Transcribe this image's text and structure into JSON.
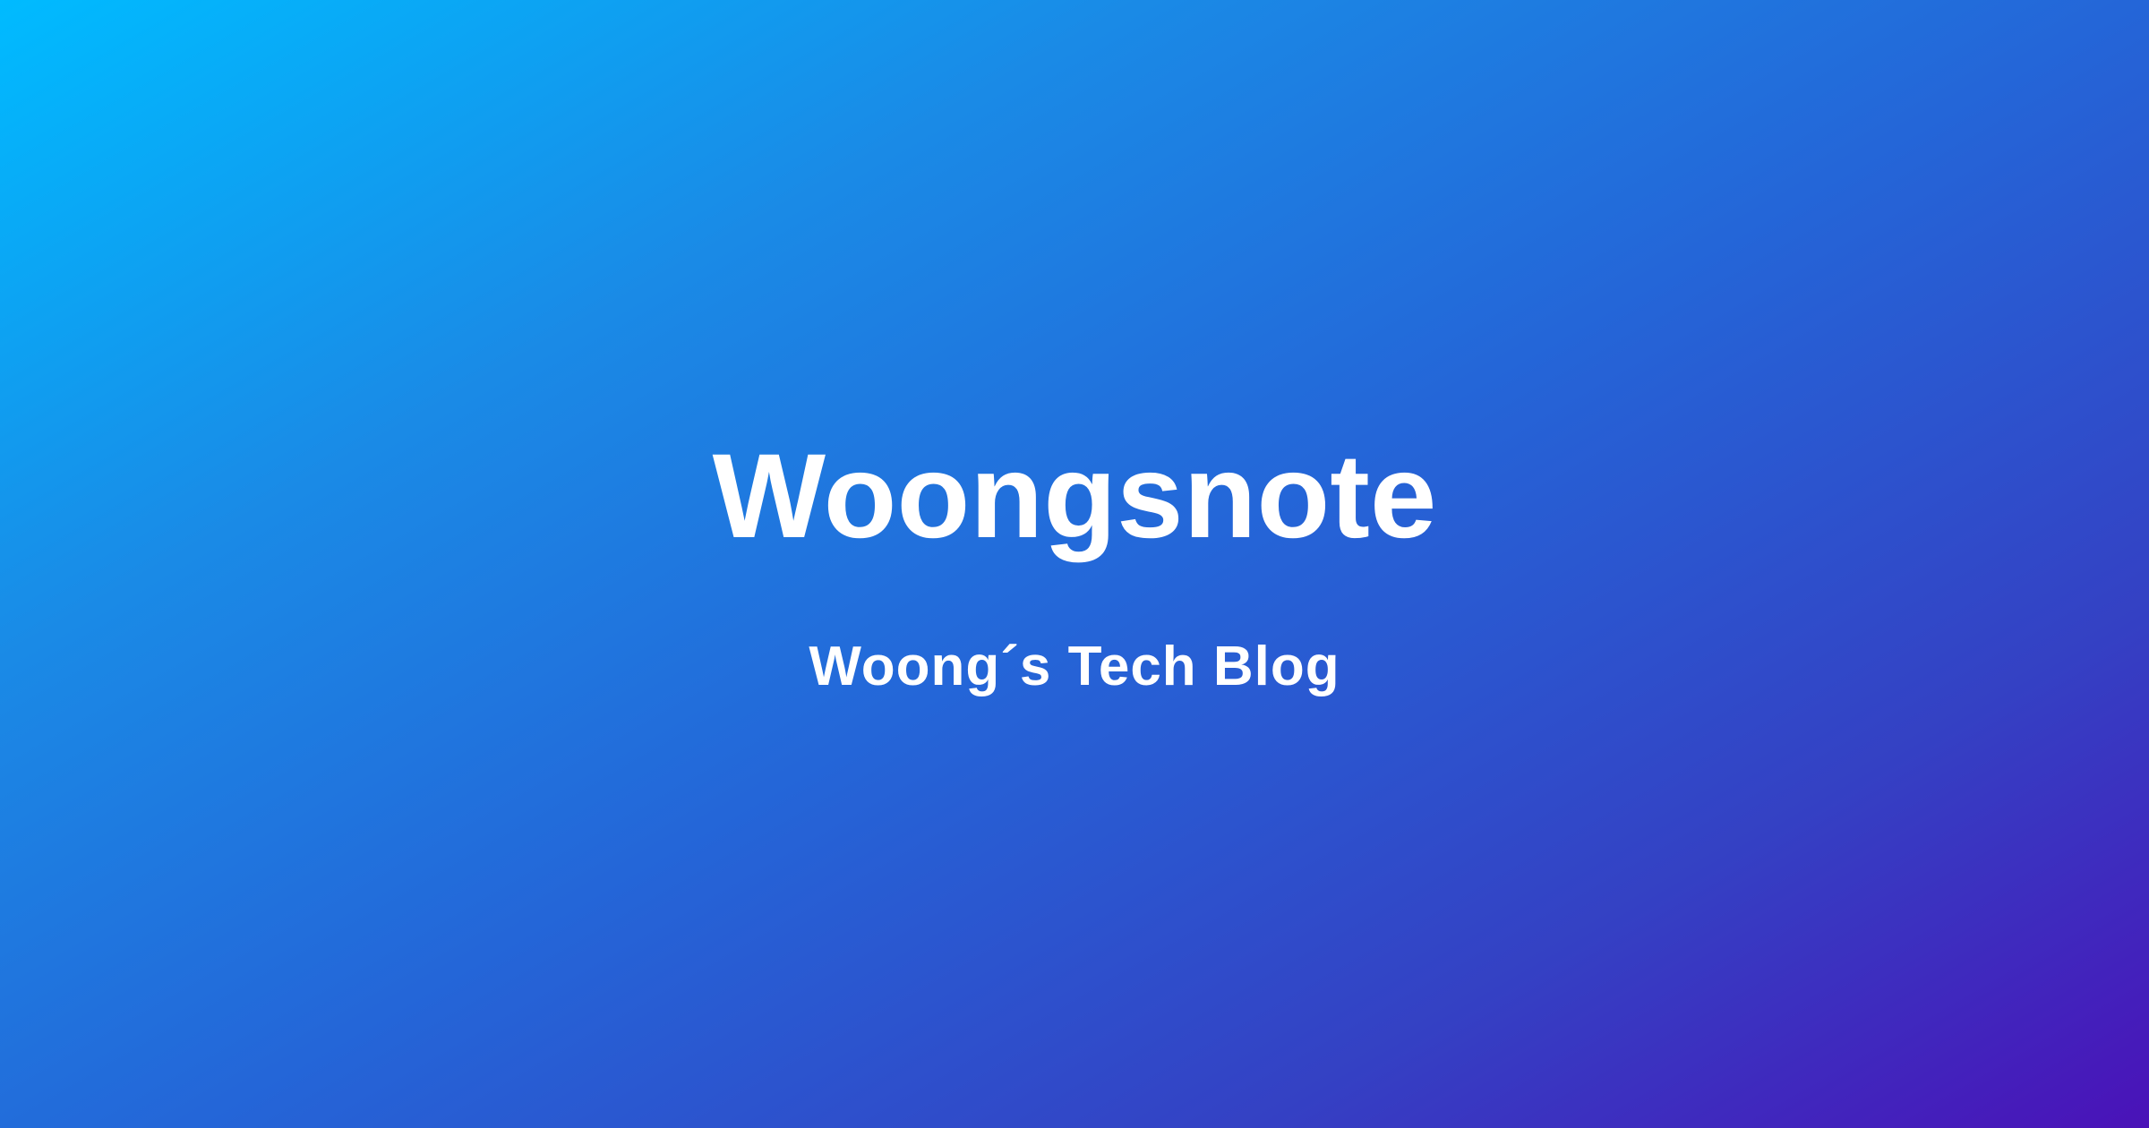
{
  "hero": {
    "title": "Woongsnote",
    "subtitle": "Woong´s Tech Blog"
  },
  "colors": {
    "gradient_start": "#00bbff",
    "gradient_mid": "#2466d8",
    "gradient_end": "#4a12b8",
    "text": "#ffffff"
  }
}
